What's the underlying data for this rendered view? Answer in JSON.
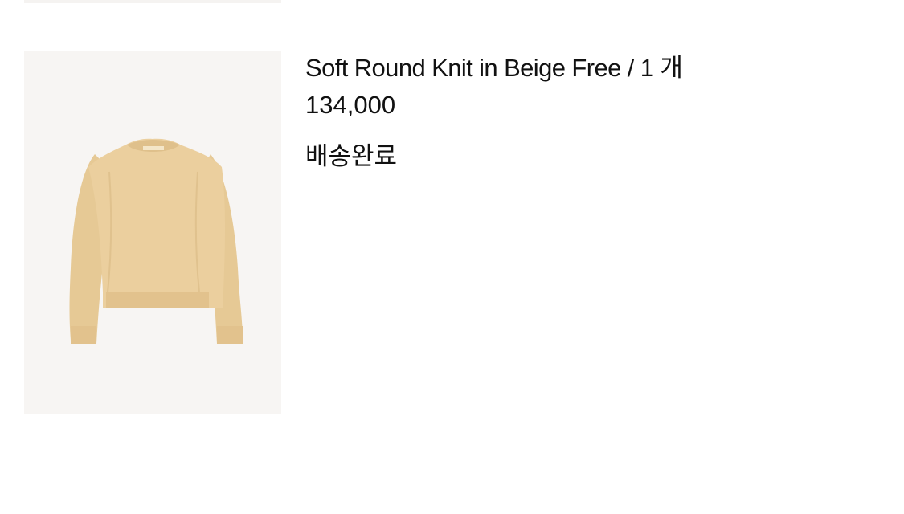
{
  "order_item": {
    "image_alt": "Soft Round Knit in Beige",
    "title": "Soft Round Knit in Beige Free / 1 개",
    "price": "134,000",
    "status": "배송완료"
  },
  "colors": {
    "thumb_background": "#f7f5f3",
    "knit_beige": "#e8cc9a",
    "text": "#111111"
  }
}
